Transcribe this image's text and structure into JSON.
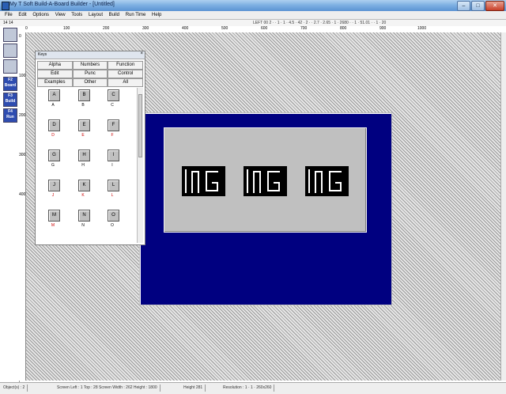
{
  "window": {
    "title": "My T Soft Build-A-Board Builder - [Untitled]"
  },
  "menu": [
    "File",
    "Edit",
    "Options",
    "View",
    "Tools",
    "Layout",
    "Build",
    "Run Time",
    "Help"
  ],
  "status_top": {
    "left": "14 14",
    "right": "LEFT 00 2 · · 1 · 1 · 4.5 · 42 · 2 · · 2.7 · 2.65 · 1 · 2680 · · 1 · 51.01 · · 1 · 20"
  },
  "ruler_marks": [
    "0",
    "100",
    "200",
    "300",
    "400",
    "500",
    "600",
    "700",
    "800",
    "900",
    "1000"
  ],
  "vruler_marks": [
    "0",
    "100",
    "200",
    "300",
    "400"
  ],
  "tools": [
    {
      "name": "pointer",
      "label": ""
    },
    {
      "name": "key-layout",
      "label": ""
    },
    {
      "name": "grid",
      "label": ""
    },
    {
      "name": "f2-board",
      "label": "F2 Board"
    },
    {
      "name": "f3-build",
      "label": "F3 Build"
    },
    {
      "name": "f4-run",
      "label": "F4 Run"
    }
  ],
  "keys_panel": {
    "title": "Keys",
    "categories": [
      "Alpha",
      "Numbers",
      "Function",
      "Edit",
      "Punc",
      "Control",
      "Examples",
      "Other",
      "All"
    ],
    "keys": [
      {
        "cap": "A",
        "label": "A"
      },
      {
        "cap": "B",
        "label": "B"
      },
      {
        "cap": "C",
        "label": "C"
      },
      {
        "cap": "D",
        "label": "D"
      },
      {
        "cap": "E",
        "label": "E"
      },
      {
        "cap": "F",
        "label": "F"
      },
      {
        "cap": "G",
        "label": "G"
      },
      {
        "cap": "H",
        "label": "H"
      },
      {
        "cap": "I",
        "label": "I"
      },
      {
        "cap": "J",
        "label": "J"
      },
      {
        "cap": "K",
        "label": "K"
      },
      {
        "cap": "L",
        "label": "L"
      },
      {
        "cap": "M",
        "label": "M"
      },
      {
        "cap": "N",
        "label": "N"
      },
      {
        "cap": "O",
        "label": "O"
      }
    ]
  },
  "board": {
    "background": "#000080",
    "inner_bg": "#c0c0c0",
    "images": [
      "IMG",
      "IMG",
      "IMG"
    ]
  },
  "status_bottom": [
    "Object(s) : 2",
    "Screen Left : 1  Top : 28  Screen Width : 262  Height : 1800",
    "Height 281",
    "Resolution : 1 · 1 · 260x260"
  ]
}
